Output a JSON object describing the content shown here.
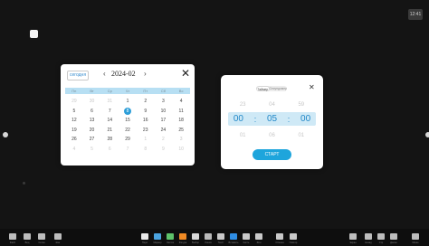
{
  "corner_badge": "12:41",
  "calendar": {
    "today_label": "сегодня",
    "prev_symbol": "‹",
    "month_label": "2024-02",
    "next_symbol": "›",
    "close_symbol": "✕",
    "weekdays": [
      "Пн",
      "Вт",
      "Ср",
      "Чт",
      "Пт",
      "Сб",
      "Вс"
    ],
    "days": [
      {
        "label": "29",
        "muted": true
      },
      {
        "label": "30",
        "muted": true
      },
      {
        "label": "31",
        "muted": true
      },
      {
        "label": "1",
        "muted": false
      },
      {
        "label": "2",
        "muted": false
      },
      {
        "label": "3",
        "muted": false
      },
      {
        "label": "4",
        "muted": false
      },
      {
        "label": "5",
        "muted": false
      },
      {
        "label": "6",
        "muted": false
      },
      {
        "label": "7",
        "muted": false
      },
      {
        "label": "8",
        "muted": false,
        "selected": true
      },
      {
        "label": "9",
        "muted": false
      },
      {
        "label": "10",
        "muted": false
      },
      {
        "label": "11",
        "muted": false
      },
      {
        "label": "12",
        "muted": false
      },
      {
        "label": "13",
        "muted": false
      },
      {
        "label": "14",
        "muted": false
      },
      {
        "label": "15",
        "muted": false
      },
      {
        "label": "16",
        "muted": false
      },
      {
        "label": "17",
        "muted": false
      },
      {
        "label": "18",
        "muted": false
      },
      {
        "label": "19",
        "muted": false
      },
      {
        "label": "20",
        "muted": false
      },
      {
        "label": "21",
        "muted": false
      },
      {
        "label": "22",
        "muted": false
      },
      {
        "label": "23",
        "muted": false
      },
      {
        "label": "24",
        "muted": false
      },
      {
        "label": "25",
        "muted": false
      },
      {
        "label": "26",
        "muted": false
      },
      {
        "label": "27",
        "muted": false
      },
      {
        "label": "28",
        "muted": false
      },
      {
        "label": "29",
        "muted": false
      },
      {
        "label": "1",
        "muted": true
      },
      {
        "label": "2",
        "muted": true
      },
      {
        "label": "3",
        "muted": true
      },
      {
        "label": "4",
        "muted": true
      },
      {
        "label": "5",
        "muted": true
      },
      {
        "label": "6",
        "muted": true
      },
      {
        "label": "7",
        "muted": true
      },
      {
        "label": "8",
        "muted": true
      },
      {
        "label": "9",
        "muted": true
      },
      {
        "label": "10",
        "muted": true
      }
    ]
  },
  "timer": {
    "mode_labels": [
      "Таймер",
      "Секундомер"
    ],
    "active_mode_index": 0,
    "close_symbol": "✕",
    "prev": [
      "23",
      "04",
      "59"
    ],
    "current": [
      "00",
      "05",
      "00"
    ],
    "colon": ":",
    "next": [
      "01",
      "06",
      "01"
    ],
    "start_label": "СТАРТ"
  },
  "taskbar": {
    "left": [
      {
        "name": "Файл",
        "icon": "file-icon"
      },
      {
        "name": "Вид",
        "icon": "view-icon"
      },
      {
        "name": "Сетка",
        "icon": "grid-icon"
      },
      {
        "name": "Шаг",
        "icon": "step-icon"
      }
    ],
    "center": [
      {
        "name": "Перо",
        "icon": "pen-icon",
        "color": "#e9e9e9"
      },
      {
        "name": "Маркер",
        "icon": "marker-icon",
        "color": "#4aa3df"
      },
      {
        "name": "Ластик",
        "icon": "eraser-icon",
        "color": "#5ec26a"
      },
      {
        "name": "Фигура",
        "icon": "shape-icon",
        "color": "#f08a24"
      },
      {
        "name": "Выбор",
        "icon": "select-icon",
        "color": "#d8d8d8"
      },
      {
        "name": "Линия",
        "icon": "line-icon",
        "color": "#b9b9b9"
      },
      {
        "name": "Текст",
        "icon": "text-icon",
        "color": "#c9c9c9"
      },
      {
        "name": "Вставить",
        "icon": "insert-icon",
        "color": "#2f8de4"
      },
      {
        "name": "Кисть",
        "icon": "brush-icon",
        "color": "#c9c9c9"
      },
      {
        "name": "Фон",
        "icon": "background-icon",
        "color": "#c9c9c9"
      },
      {
        "name": "Отмена",
        "icon": "undo-icon",
        "color": "#c9c9c9"
      },
      {
        "name": "Повтор",
        "icon": "redo-icon",
        "color": "#c9c9c9"
      }
    ],
    "right": [
      {
        "name": "Экран",
        "icon": "screen-icon"
      },
      {
        "name": "Назад",
        "icon": "back-icon"
      },
      {
        "name": "Стр",
        "icon": "page-icon"
      },
      {
        "name": "Далее",
        "icon": "next-icon"
      },
      {
        "name": "Меню",
        "icon": "menu-icon"
      }
    ]
  }
}
